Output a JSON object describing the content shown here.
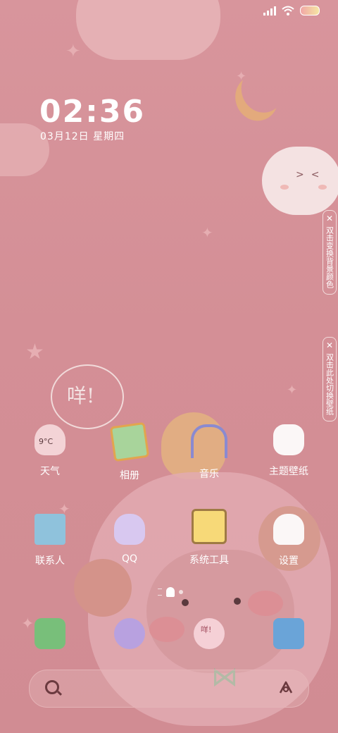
{
  "status_bar": {
    "icons": [
      "signal-icon",
      "wifi-icon",
      "battery-icon"
    ]
  },
  "clock": {
    "time": "02:36",
    "date": "03月12日 星期四"
  },
  "hints": [
    {
      "text": "双击变换背景颜色",
      "close": "✕"
    },
    {
      "text": "双击此处切换壁纸",
      "close": "✕"
    }
  ],
  "decoration": {
    "speech_bubble": "咩!"
  },
  "apps_row1": [
    {
      "label": "天气",
      "icon": "weather-icon",
      "temp": "9°C"
    },
    {
      "label": "相册",
      "icon": "album-icon"
    },
    {
      "label": "音乐",
      "icon": "music-icon"
    },
    {
      "label": "主题壁纸",
      "icon": "theme-icon"
    }
  ],
  "apps_row2": [
    {
      "label": "联系人",
      "icon": "contacts-icon"
    },
    {
      "label": "QQ",
      "icon": "qq-icon"
    },
    {
      "label": "系统工具",
      "icon": "tools-icon"
    },
    {
      "label": "设置",
      "icon": "settings-icon"
    }
  ],
  "dock": [
    {
      "icon": "phone-icon"
    },
    {
      "icon": "planet-browser-icon"
    },
    {
      "icon": "messages-icon",
      "text": "咩!"
    },
    {
      "icon": "camera-icon"
    }
  ],
  "search": {
    "placeholder": ""
  },
  "colors": {
    "background": "#d48f96",
    "text": "#ffffff",
    "accent": "#6b3a3f"
  }
}
